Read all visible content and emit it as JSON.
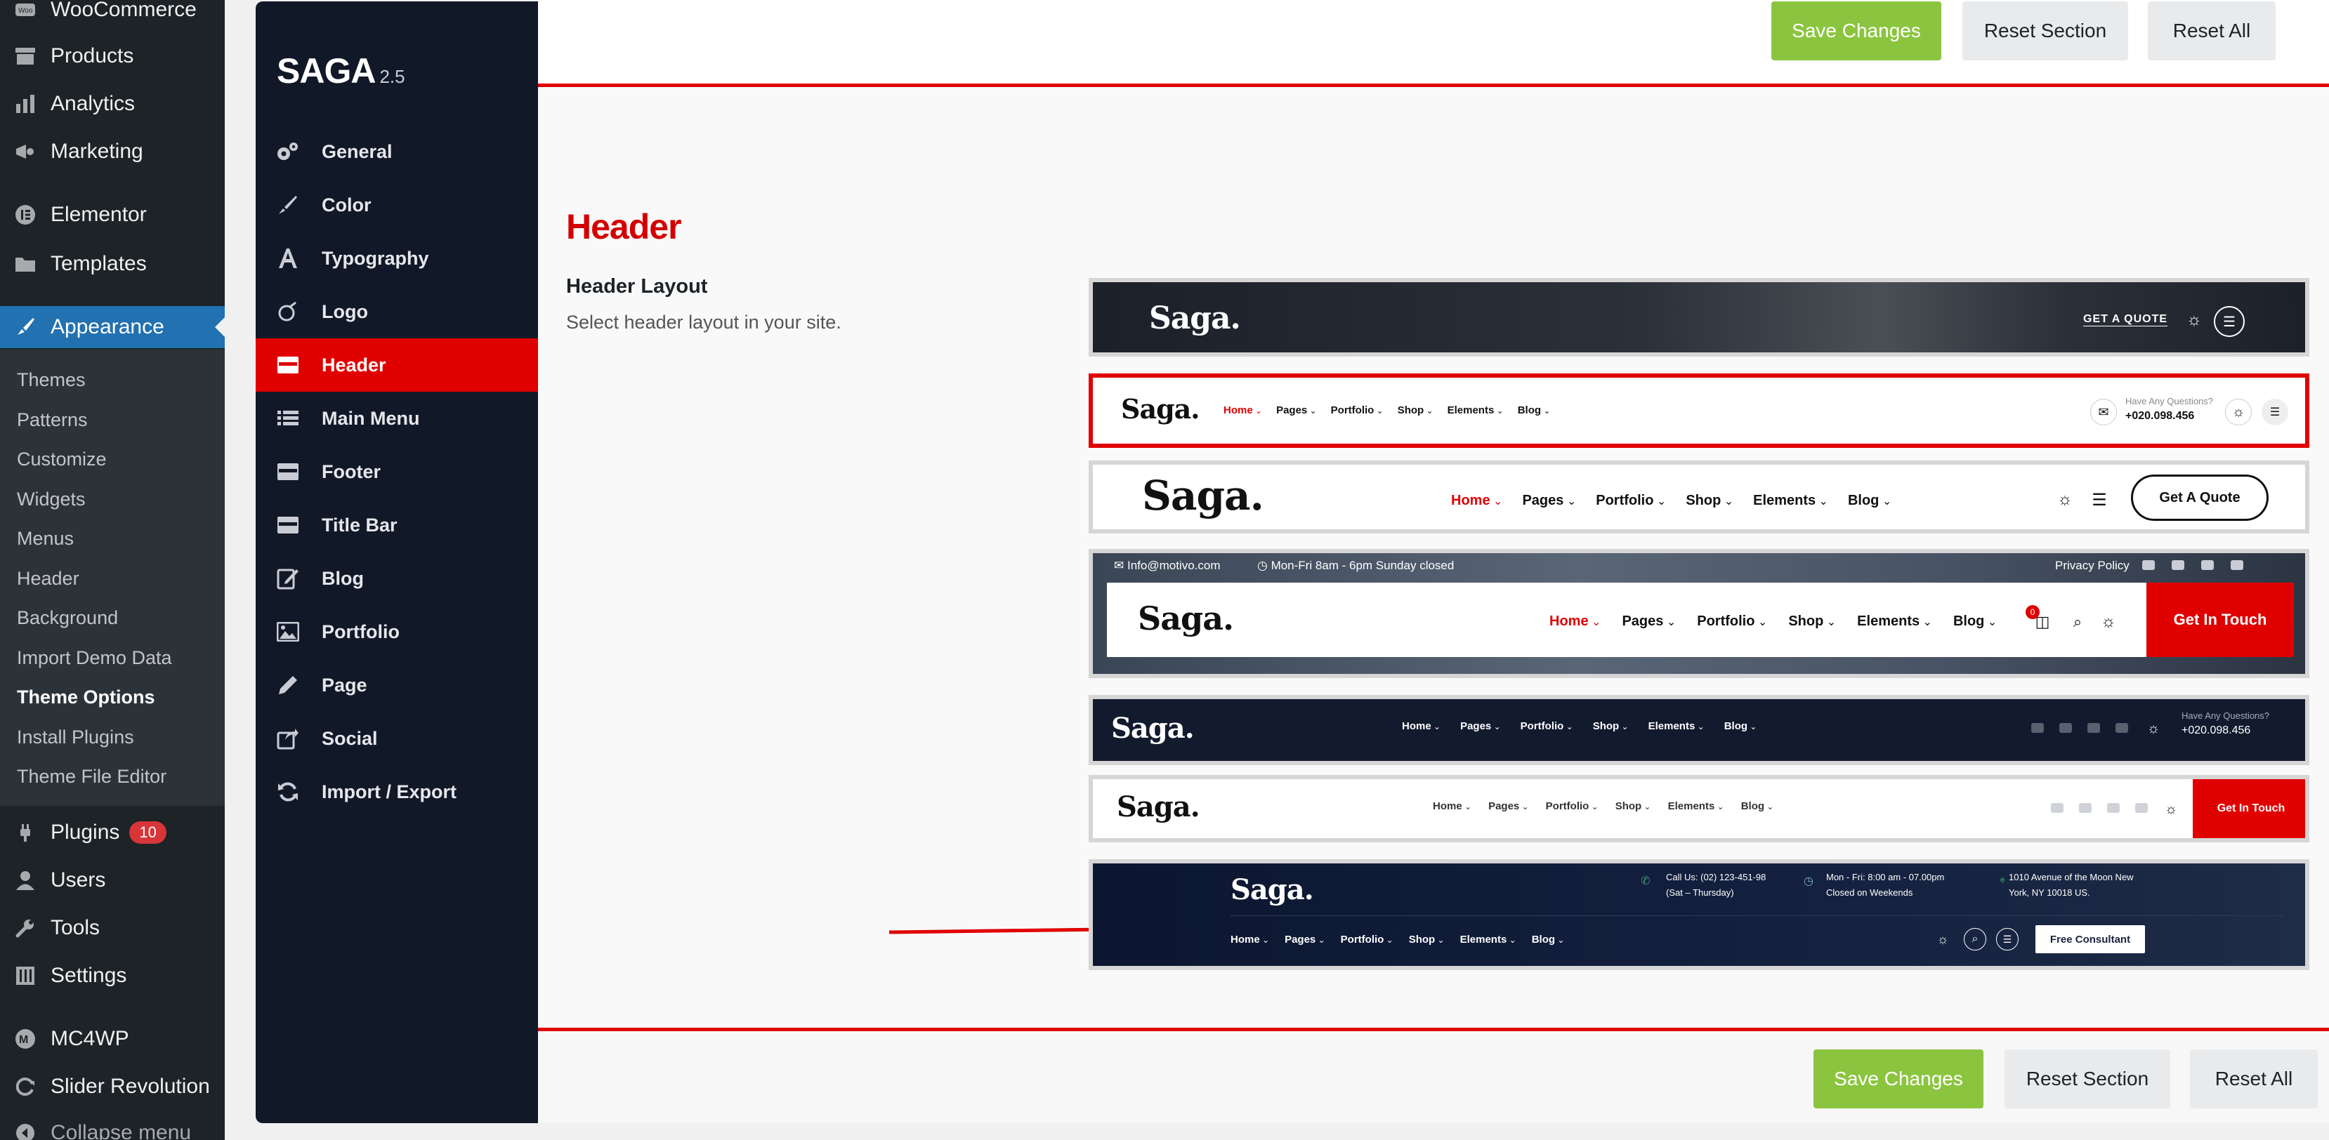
{
  "wp_menu": {
    "items": [
      {
        "label": "WooCommerce",
        "icon": "woo-icon"
      },
      {
        "label": "Products",
        "icon": "archive-icon"
      },
      {
        "label": "Analytics",
        "icon": "bar-chart-icon"
      },
      {
        "label": "Marketing",
        "icon": "megaphone-icon"
      },
      {
        "label": "Elementor",
        "icon": "elementor-icon"
      },
      {
        "label": "Templates",
        "icon": "folder-icon"
      },
      {
        "label": "Appearance",
        "icon": "paintbrush-icon"
      },
      {
        "label": "Plugins",
        "icon": "plug-icon",
        "badge": "10"
      },
      {
        "label": "Users",
        "icon": "user-icon"
      },
      {
        "label": "Tools",
        "icon": "wrench-icon"
      },
      {
        "label": "Settings",
        "icon": "settings-icon"
      },
      {
        "label": "MC4WP",
        "icon": "mc4wp-icon"
      },
      {
        "label": "Slider Revolution",
        "icon": "refresh-icon"
      },
      {
        "label": "Collapse menu",
        "icon": "collapse-icon"
      }
    ],
    "submenu": [
      "Themes",
      "Patterns",
      "Customize",
      "Widgets",
      "Menus",
      "Header",
      "Background",
      "Import Demo Data",
      "Theme Options",
      "Install Plugins",
      "Theme File Editor"
    ]
  },
  "panel": {
    "brand": "SAGA",
    "version": "2.5",
    "nav": [
      {
        "label": "General",
        "icon": "gears-icon"
      },
      {
        "label": "Color",
        "icon": "brush-icon"
      },
      {
        "label": "Typography",
        "icon": "font-icon"
      },
      {
        "label": "Logo",
        "icon": "logo-icon"
      },
      {
        "label": "Header",
        "icon": "header-icon"
      },
      {
        "label": "Main Menu",
        "icon": "list-icon"
      },
      {
        "label": "Footer",
        "icon": "footer-icon"
      },
      {
        "label": "Title Bar",
        "icon": "titlebar-icon"
      },
      {
        "label": "Blog",
        "icon": "edit-icon"
      },
      {
        "label": "Portfolio",
        "icon": "image-icon"
      },
      {
        "label": "Page",
        "icon": "pencil-icon"
      },
      {
        "label": "Social",
        "icon": "share-icon"
      },
      {
        "label": "Import / Export",
        "icon": "refresh-icon"
      }
    ]
  },
  "buttons": {
    "save": "Save Changes",
    "reset_section": "Reset Section",
    "reset_all": "Reset All"
  },
  "section": {
    "title": "Header",
    "field_title": "Header Layout",
    "field_desc": "Select header layout in your site."
  },
  "colors": {
    "accent": "#e00000",
    "wp_blue": "#2271b1",
    "save_green": "#8bc53f",
    "panel_bg": "#111827"
  },
  "headers": {
    "logo": "Saga.",
    "nav": [
      "Home",
      "Pages",
      "Portfolio",
      "Shop",
      "Elements",
      "Blog"
    ],
    "h1": {
      "quote": "GET A QUOTE"
    },
    "h2": {
      "question": "Have Any Questions?",
      "phone": "+020.098.456"
    },
    "h3": {
      "cta": "Get A Quote"
    },
    "h4": {
      "email": "Info@motivo.com",
      "hours": "Mon-Fri 8am - 6pm Sunday closed",
      "privacy": "Privacy Policy",
      "cart_count": "0",
      "cta": "Get In Touch"
    },
    "h5": {
      "question": "Have Any Questions?",
      "phone": "+020.098.456"
    },
    "h6": {
      "cta": "Get In Touch"
    },
    "h7": {
      "call": "Call Us: (02) 123-451-98",
      "call_days": "(Sat – Thursday)",
      "hours": "Mon - Fri: 8:00 am - 07.00pm",
      "hours2": "Closed on Weekends",
      "address": "1010 Avenue of the Moon New",
      "address2": "York, NY 10018 US.",
      "cta": "Free Consultant"
    }
  }
}
